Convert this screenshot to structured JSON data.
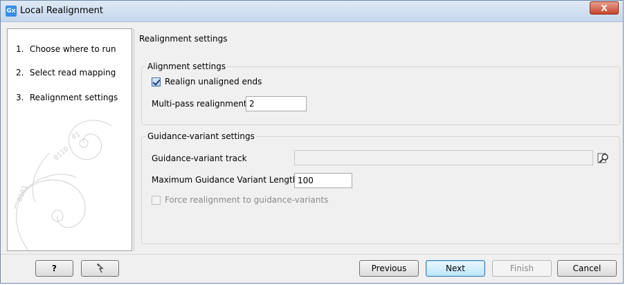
{
  "window": {
    "title": "Local Realignment",
    "app_icon_text": "Gx",
    "close_label": "X"
  },
  "steps": [
    {
      "num": "1.",
      "label": "Choose where to run"
    },
    {
      "num": "2.",
      "label": "Select read mapping"
    },
    {
      "num": "3.",
      "label": "Realignment settings"
    }
  ],
  "content": {
    "title": "Realignment settings",
    "alignment_group": {
      "title": "Alignment settings",
      "realign_label": "Realign unaligned ends",
      "realign_checked": true,
      "multipass_label": "Multi-pass realignment",
      "multipass_value": "2"
    },
    "guidance_group": {
      "title": "Guidance-variant settings",
      "track_label": "Guidance-variant track",
      "track_value": "",
      "max_len_label": "Maximum Guidance Variant Length",
      "max_len_value": "100",
      "force_label": "Force realignment to guidance-variants",
      "force_checked": false
    }
  },
  "buttons": {
    "help": "?",
    "previous": "Previous",
    "next": "Next",
    "finish": "Finish",
    "cancel": "Cancel"
  },
  "colors": {
    "accent": "#3c7fb1",
    "close": "#c7452b"
  }
}
